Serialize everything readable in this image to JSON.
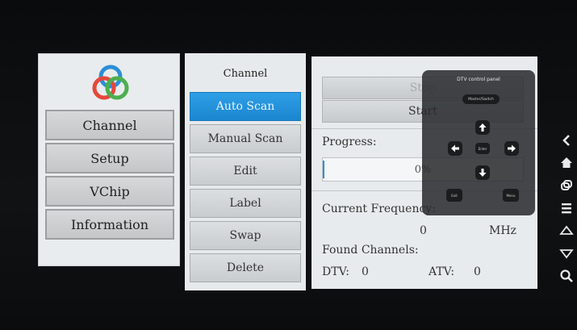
{
  "left_menu": {
    "items": [
      {
        "label": "Channel"
      },
      {
        "label": "Setup"
      },
      {
        "label": "VChip"
      },
      {
        "label": "Information"
      }
    ]
  },
  "channel_menu": {
    "title": "Channel",
    "items": [
      {
        "label": "Auto Scan",
        "active": true
      },
      {
        "label": "Manual Scan",
        "active": false
      },
      {
        "label": "Edit",
        "active": false
      },
      {
        "label": "Label",
        "active": false
      },
      {
        "label": "Swap",
        "active": false
      },
      {
        "label": "Delete",
        "active": false
      }
    ]
  },
  "scan_panel": {
    "stop_label": "Stop",
    "start_label": "Start",
    "progress_label": "Progress:",
    "progress_value": "0%",
    "progress_fraction": 0.0,
    "current_frequency_label": "Current Frequency:",
    "frequency_value": "0",
    "frequency_unit": "MHz",
    "found_channels_label": "Found Channels:",
    "dtv_label": "DTV:",
    "dtv_count": "0",
    "atv_label": "ATV:",
    "atv_count": "0"
  },
  "dtv_control_panel": {
    "title": "DTV control panel",
    "mode_button": "Master/Switch",
    "enter_label": "Enter",
    "exit_label": "Exit",
    "menu_label": "Menu"
  },
  "side_nav": {
    "icons": [
      "back-icon",
      "home-icon",
      "window-icon",
      "menu-icon",
      "up-icon",
      "down-icon",
      "search-icon"
    ]
  },
  "colors": {
    "accent_blue": "#1b86cf",
    "panel_bg": "#e8ebed",
    "screen_black": "#0b0c0e"
  }
}
